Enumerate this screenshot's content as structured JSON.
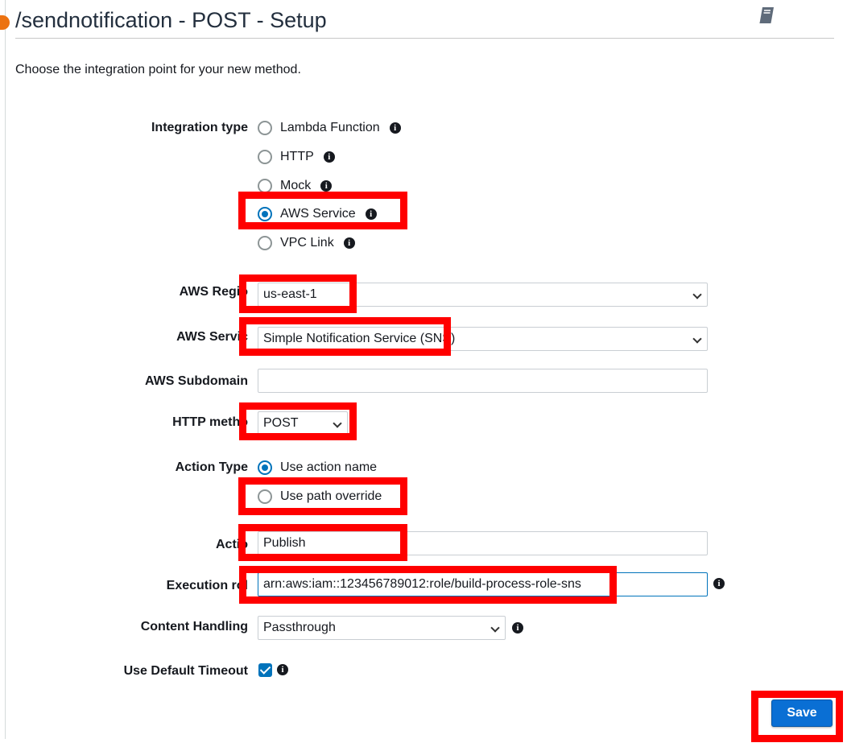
{
  "header": {
    "title": "/sendnotification - POST - Setup",
    "intro": "Choose the integration point for your new method."
  },
  "form": {
    "integration_type": {
      "label": "Integration type",
      "options": [
        "Lambda Function",
        "HTTP",
        "Mock",
        "AWS Service",
        "VPC Link"
      ],
      "selected": "AWS Service"
    },
    "aws_region": {
      "label": "AWS Regio",
      "value": "us-east-1"
    },
    "aws_service": {
      "label": "AWS Servic",
      "value": "Simple Notification Service (SNS)"
    },
    "aws_subdomain": {
      "label": "AWS Subdomain",
      "value": ""
    },
    "http_method": {
      "label": "HTTP metho",
      "value": "POST"
    },
    "action_type": {
      "label": "Action Type",
      "options": [
        "Use action name",
        "Use path override"
      ],
      "selected": "Use action name"
    },
    "action": {
      "label": "Actio",
      "value": "Publish"
    },
    "execution_role": {
      "label": "Execution rol",
      "value": "arn:aws:iam::123456789012:role/build-process-role-sns"
    },
    "content_handling": {
      "label": "Content Handling",
      "value": "Passthrough"
    },
    "use_default_timeout": {
      "label": "Use Default Timeout",
      "checked": true
    }
  },
  "actions": {
    "save_label": "Save"
  },
  "colors": {
    "accent": "#0073bb",
    "highlight": "#ff0000",
    "button": "#0a6fd4"
  },
  "icons": [
    "book-icon",
    "info-icon",
    "chevron-down-icon",
    "checkmark-icon"
  ]
}
